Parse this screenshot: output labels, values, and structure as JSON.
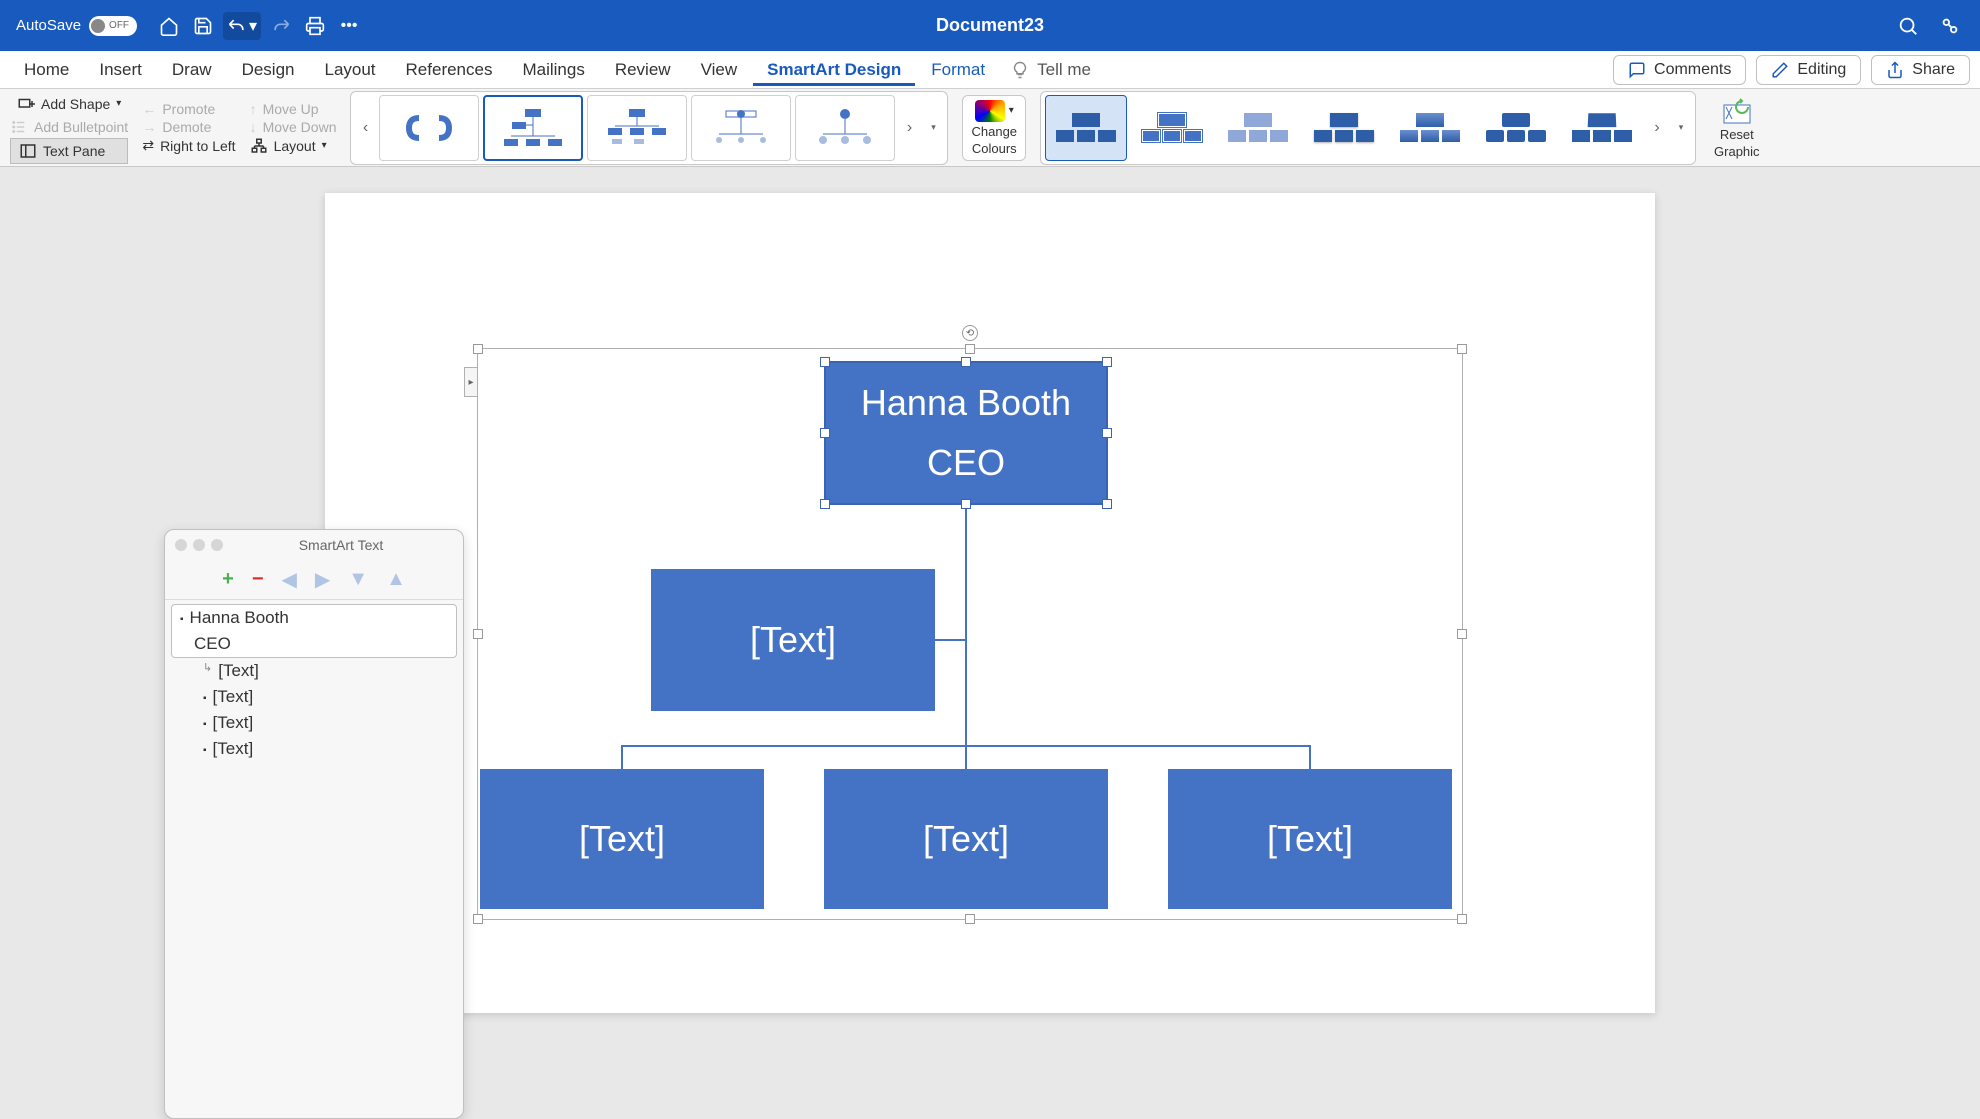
{
  "titlebar": {
    "autosave_label": "AutoSave",
    "autosave_state": "OFF",
    "doc_title": "Document23"
  },
  "ribbon_tabs": {
    "home": "Home",
    "insert": "Insert",
    "draw": "Draw",
    "design": "Design",
    "layout": "Layout",
    "references": "References",
    "mailings": "Mailings",
    "review": "Review",
    "view": "View",
    "smartart_design": "SmartArt Design",
    "format": "Format",
    "tell_me": "Tell me"
  },
  "ribbon_right": {
    "comments": "Comments",
    "editing": "Editing",
    "share": "Share"
  },
  "ribbon": {
    "add_shape": "Add Shape",
    "add_bulletpoint": "Add Bulletpoint",
    "text_pane": "Text Pane",
    "promote": "Promote",
    "demote": "Demote",
    "right_to_left": "Right to Left",
    "move_up": "Move Up",
    "move_down": "Move Down",
    "layout": "Layout",
    "change_colours_1": "Change",
    "change_colours_2": "Colours",
    "reset_1": "Reset",
    "reset_2": "Graphic"
  },
  "smartart_panel": {
    "title": "SmartArt Text",
    "items": [
      {
        "line1": "Hanna Booth",
        "line2": "CEO"
      },
      {
        "text": "[Text]"
      },
      {
        "text": "[Text]"
      },
      {
        "text": "[Text]"
      },
      {
        "text": "[Text]"
      }
    ]
  },
  "org_chart": {
    "top_line1": "Hanna Booth",
    "top_line2": "CEO",
    "assistant": "[Text]",
    "bottom1": "[Text]",
    "bottom2": "[Text]",
    "bottom3": "[Text]"
  },
  "style_colors": [
    "#2e5ea8",
    "#4472c4",
    "#6c8fd0",
    "#2e5ea8",
    "#2e5ea8",
    "#2e5ea8",
    "#2e5ea8"
  ]
}
